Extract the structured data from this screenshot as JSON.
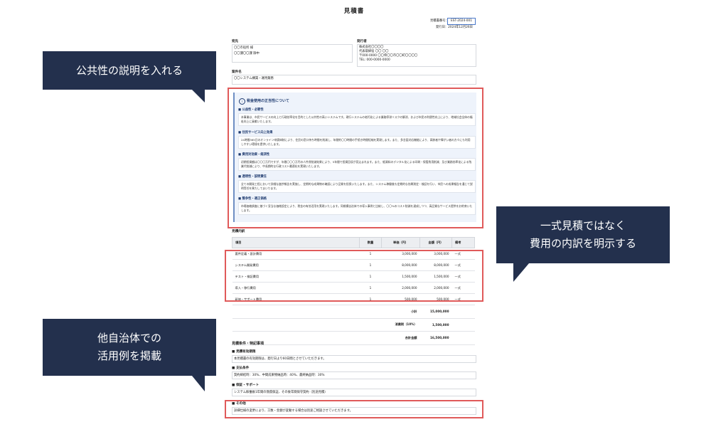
{
  "doc": {
    "title": "見積書",
    "estimate_no_label": "見積書番号：",
    "estimate_no": "EST-2024-001",
    "issue_date": "発行日：2024年12月26日",
    "recipient_label": "宛先",
    "recipient_lines": [
      "〇〇市役所 様",
      "〇〇課〇〇課 御中"
    ],
    "issuer_label": "発行者",
    "issuer_lines": [
      "株式会社〇〇〇〇",
      "代表取締役 〇〇 〇〇",
      "〒000-0000 〇〇県〇〇市〇〇町〇〇〇〇",
      "TEL: 000-0000-0000"
    ],
    "subject_label": "案件名",
    "subject": "〇〇システム構築・運用業務",
    "justification": {
      "heading": "税金使用の正当性について",
      "sections": [
        {
          "title": "■ 公益性・必要性",
          "text": "本事業は、市民サービスの向上と行政効率化を目的とした公共性の高いシステムです。現行システムの老朽化による業務停滞リスクの解消、および市民の利便性向上により、地域社会全体の福祉向上に貢献いたします。"
        },
        {
          "title": "■ 住民サービス向上効果",
          "text": "24時間365日のオンライン申請体制により、住民の窓口待ち時間を削減し、年間約〇〇時間の手続き時間短縮を実現します。また、多言語対応機能により、高齢者や障がい者の方々にも利用しやすい環境を提供いたします。"
        },
        {
          "title": "■ 費用対効果・経済性",
          "text": "初期投資額は〇〇〇万円ですが、年間〇〇〇万円の人件費削減効果により、5年間で投資回収が見込まれます。また、紙資料のデジタル化による印刷・保管費用削減、及び業務効率化による残業代削減により、中長期的な行政コスト最適化を実現いたします。"
        },
        {
          "title": "■ 透明性・説明責任",
          "text": "全ての開発工程において詳細な進捗報告を実施し、定期的な成果物の確認により品質を担保いたします。また、システム稼働後も定期的な効果測定・検証を行い、市民への成果報告を通じて説明責任を果たしてまいります。"
        },
        {
          "title": "■ 競争性・適正価格",
          "text": "市場価格調査に基づく妥当な価格設定により、税金の有効活用を実現いたします。同規模自治体での導入事例と比較し、〇〇%のコスト削減を達成しつつ、高品質なサービス提供をお約束いたします。"
        }
      ]
    },
    "breakdown_label": "見積内訳",
    "table": {
      "headers": [
        "項目",
        "数量",
        "単価（円）",
        "金額（円）",
        "備考"
      ],
      "rows": [
        {
          "item": "要件定義・設計費用",
          "qty": "1",
          "unit": "3,000,000",
          "amount": "3,000,000",
          "note": "一式"
        },
        {
          "item": "システム開発費用",
          "qty": "1",
          "unit": "8,000,000",
          "amount": "8,000,000",
          "note": "一式"
        },
        {
          "item": "テスト・検証費用",
          "qty": "1",
          "unit": "1,500,000",
          "amount": "1,500,000",
          "note": "一式"
        },
        {
          "item": "導入・移行費用",
          "qty": "1",
          "unit": "2,000,000",
          "amount": "2,000,000",
          "note": "一式"
        },
        {
          "item": "研修・サポート費用",
          "qty": "1",
          "unit": "500,000",
          "amount": "500,000",
          "note": "一式"
        }
      ],
      "subtotal_label": "小計",
      "subtotal": "15,000,000",
      "tax_label": "消費税（10%）",
      "tax": "1,500,000",
      "total_label": "合計金額",
      "total": "16,500,000"
    },
    "conditions_label": "見積条件・特記事項",
    "conditions": [
      {
        "title": "■ 見積有効期限",
        "text": "本見積書の有効期限は、発行日より60日間とさせていただきます。"
      },
      {
        "title": "■ 支払条件",
        "text": "契約締結時：30%、中間成果物納品時：40%、最終納品時：30%"
      },
      {
        "title": "■ 保証・サポート",
        "text": "システム稼働後1年間の無償保証、その後年間保守契約（別途見積）"
      },
      {
        "title": "■ その他",
        "text": "詳細仕様の変更により、工数・金額が変動する場合は別途ご相談させていただきます。"
      }
    ]
  },
  "callouts": {
    "c1": "公共性の説明を入れる",
    "c2_line1": "一式見積ではなく",
    "c2_line2": "費用の内訳を明示する",
    "c3_line1": "他自治体での",
    "c3_line2": "活用例を掲載"
  },
  "colors": {
    "callout_bg": "#23304d",
    "highlight": "#e05a5a",
    "accent": "#1f3b70"
  }
}
